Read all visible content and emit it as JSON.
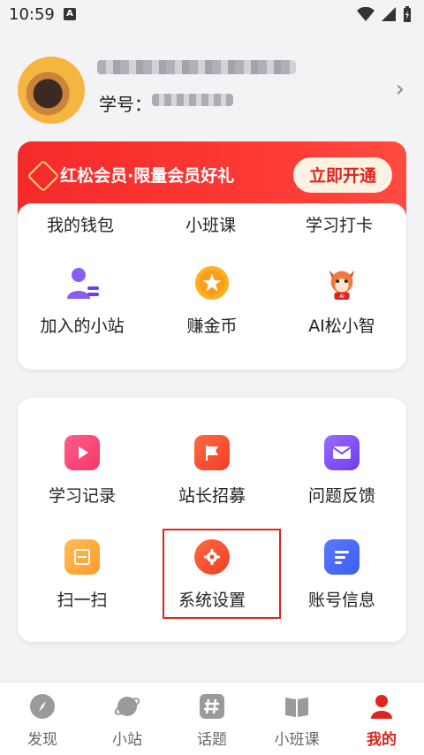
{
  "status_bar": {
    "time": "10:59",
    "notification_icon": "A"
  },
  "profile": {
    "student_id_label": "学号："
  },
  "vip_banner": {
    "text": "红松会员·限量会员好礼",
    "button": "立即开通"
  },
  "card1": {
    "partial_row": [
      "我的钱包",
      "小班课",
      "学习打卡"
    ],
    "items": [
      {
        "label": "加入的小站",
        "icon": "user-list-icon"
      },
      {
        "label": "赚金币",
        "icon": "coin-star-icon"
      },
      {
        "label": "AI松小智",
        "icon": "squirrel-mascot-icon"
      }
    ]
  },
  "card2": {
    "items": [
      {
        "label": "学习记录",
        "icon": "play-icon"
      },
      {
        "label": "站长招募",
        "icon": "flag-icon"
      },
      {
        "label": "问题反馈",
        "icon": "mail-icon"
      },
      {
        "label": "扫一扫",
        "icon": "scan-icon"
      },
      {
        "label": "系统设置",
        "icon": "gear-icon"
      },
      {
        "label": "账号信息",
        "icon": "document-icon"
      }
    ]
  },
  "tabs": [
    {
      "label": "发现",
      "icon": "compass-icon"
    },
    {
      "label": "小站",
      "icon": "planet-icon"
    },
    {
      "label": "话题",
      "icon": "hashtag-icon"
    },
    {
      "label": "小班课",
      "icon": "book-icon"
    },
    {
      "label": "我的",
      "icon": "person-icon",
      "active": true
    }
  ],
  "colors": {
    "accent": "#e0231c",
    "vip_start": "#f32a2a",
    "vip_button_bg": "#fff2e2"
  }
}
